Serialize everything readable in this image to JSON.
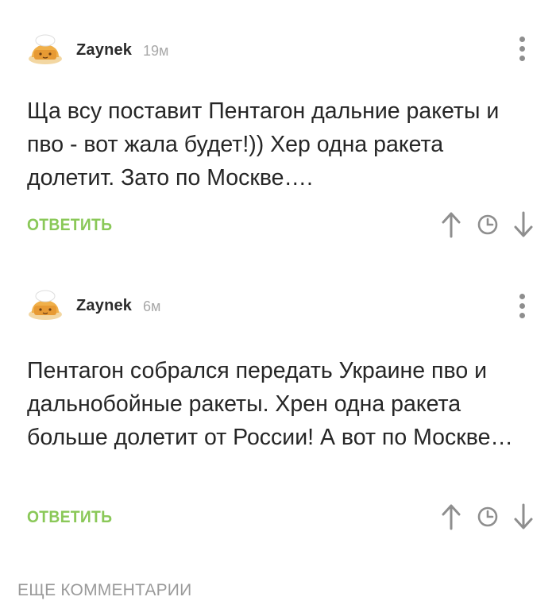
{
  "comments": [
    {
      "username": "Zaynek",
      "time": "19м",
      "text": "Ща всу поставит Пентагон дальние ракеты и пво - вот жала будет!)) Хер одна ракета долетит. Зато по Москве….",
      "reply_label": "ОТВЕТИТЬ"
    },
    {
      "username": "Zaynek",
      "time": "6м",
      "text": "Пентагон собрался передать Украине пво и дальнобойные ракеты. Хрен одна ракета больше долетит от России! А вот по Москве…",
      "reply_label": "ОТВЕТИТЬ"
    }
  ],
  "footer": {
    "more_comments_label": "ЕЩЕ КОММЕНТАРИИ"
  },
  "icons": {
    "avatar": "baker-cat-avatar-icon",
    "menu": "more-vertical-icon",
    "upvote": "arrow-up-icon",
    "time": "clock-icon",
    "downvote": "arrow-down-icon"
  },
  "colors": {
    "reply": "#8ac858",
    "text": "#262626",
    "muted": "#a8a8a8",
    "icon": "#8e8e8e"
  }
}
